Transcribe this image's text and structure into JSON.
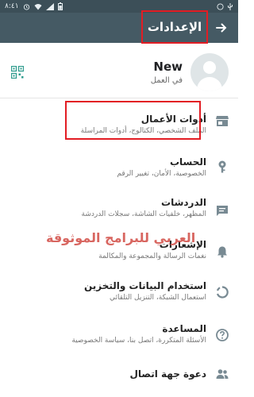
{
  "status_bar": {
    "time": "٨:٤١",
    "icons": [
      "alarm-icon",
      "wifi-icon",
      "signal-icon",
      "battery-icon"
    ]
  },
  "appbar": {
    "title": "الإعدادات",
    "back_icon": "arrow-right-icon",
    "color": "#455a64",
    "highlight_color": "#e21d24"
  },
  "profile": {
    "name": "New",
    "status": "في العمل",
    "qr_icon": "qr-code-icon"
  },
  "rows": [
    {
      "label": "أدوات الأعمال",
      "sub": "الملف الشخصي، الكتالوج، أدوات المراسلة",
      "icon": "store-icon"
    },
    {
      "label": "الحساب",
      "sub": "الخصوصية، الأمان، تغيير الرقم",
      "icon": "key-icon"
    },
    {
      "label": "الدردشات",
      "sub": "المظهر، خلفيات الشاشة، سجلات الدردشة",
      "icon": "chat-icon"
    },
    {
      "label": "الإشعارات",
      "sub": "نغمات الرسالة والمجموعة والمكالمة",
      "icon": "bell-icon"
    },
    {
      "label": "استخدام البيانات والتخزين",
      "sub": "استعمال الشبكة، التنزيل التلقائي",
      "icon": "data-usage-icon"
    },
    {
      "label": "المساعدة",
      "sub": "الأسئلة المتكررة، اتصل بنا، سياسة الخصوصية",
      "icon": "help-icon"
    },
    {
      "label": "دعوة جهة اتصال",
      "sub": "",
      "icon": "people-icon"
    }
  ],
  "watermark": "العربي للبرامج الموثوقة"
}
